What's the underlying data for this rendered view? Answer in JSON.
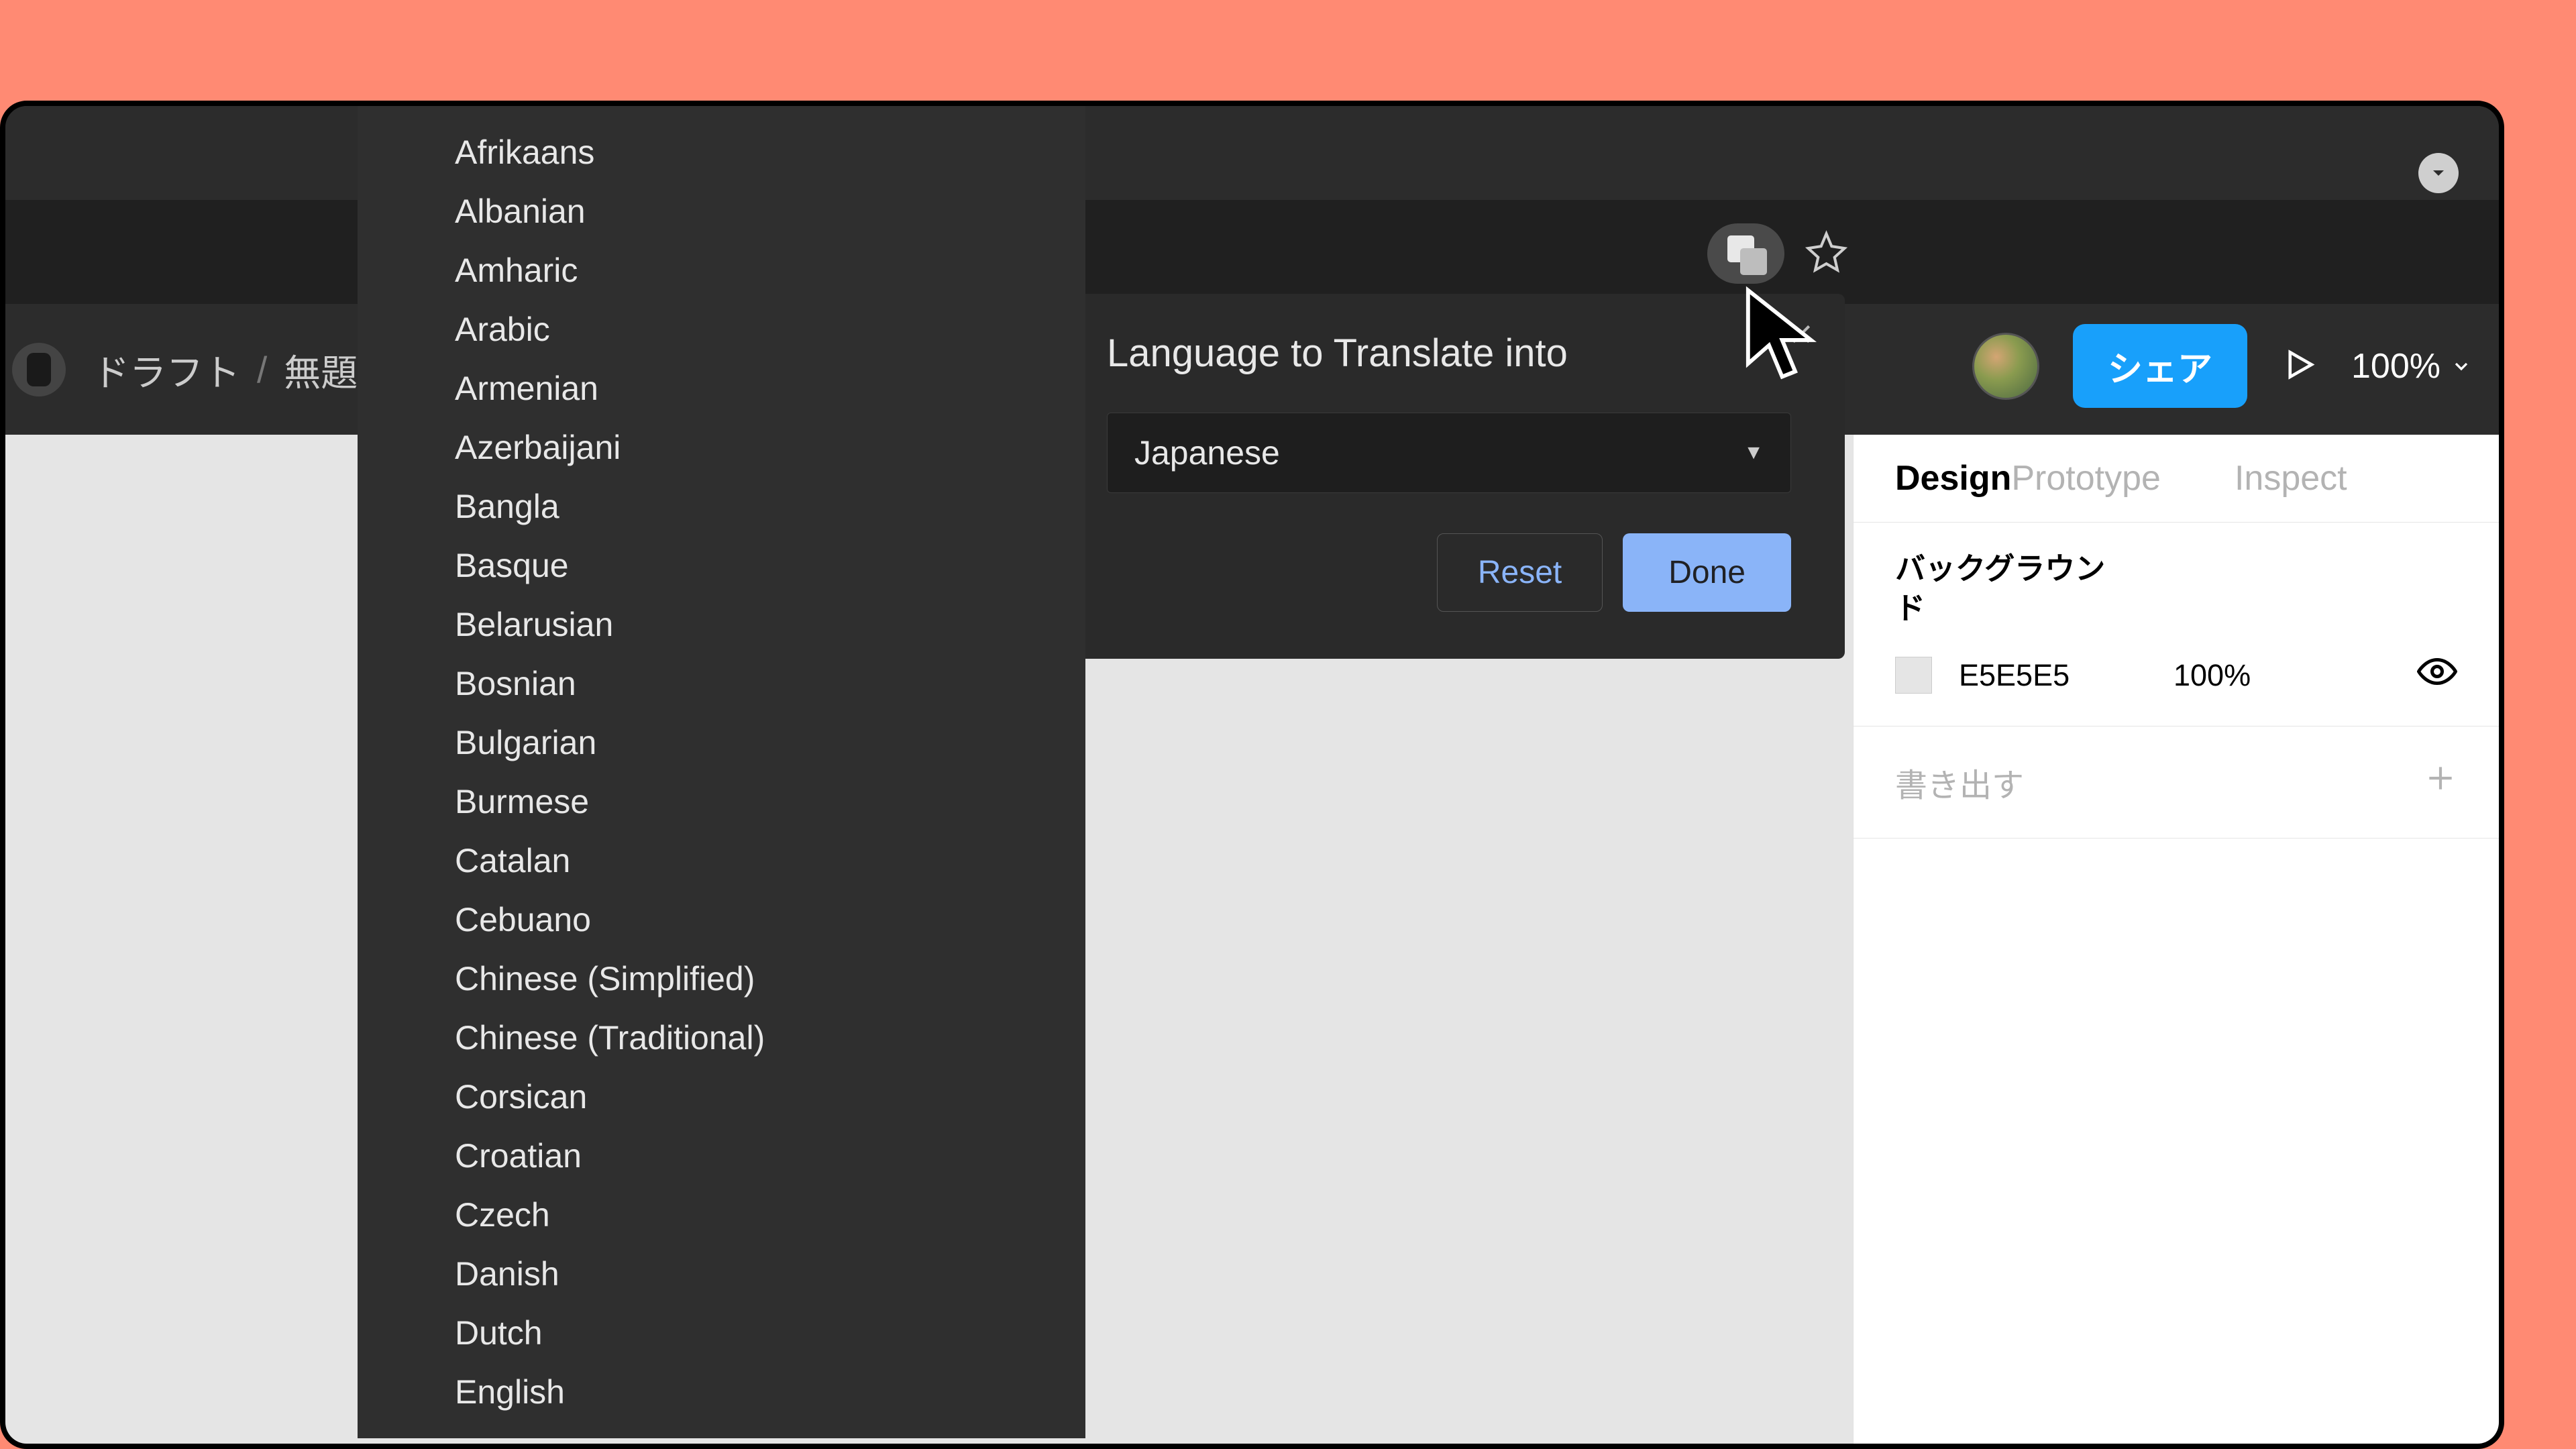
{
  "breadcrumb": {
    "drafts": "ドラフト",
    "untitled": "無題"
  },
  "header": {
    "share": "シェア",
    "zoom": "100%"
  },
  "panel": {
    "tabs": [
      "Design",
      "Prototype",
      "Inspect"
    ],
    "bg_label": "バックグラウンド",
    "bg_hex": "E5E5E5",
    "bg_opacity": "100%",
    "export": "書き出す"
  },
  "translate_popover": {
    "title": "Language to Translate into",
    "selected": "Japanese",
    "reset": "Reset",
    "done": "Done"
  },
  "languages": [
    "Afrikaans",
    "Albanian",
    "Amharic",
    "Arabic",
    "Armenian",
    "Azerbaijani",
    "Bangla",
    "Basque",
    "Belarusian",
    "Bosnian",
    "Bulgarian",
    "Burmese",
    "Catalan",
    "Cebuano",
    "Chinese (Simplified)",
    "Chinese (Traditional)",
    "Corsican",
    "Croatian",
    "Czech",
    "Danish",
    "Dutch",
    "English"
  ]
}
